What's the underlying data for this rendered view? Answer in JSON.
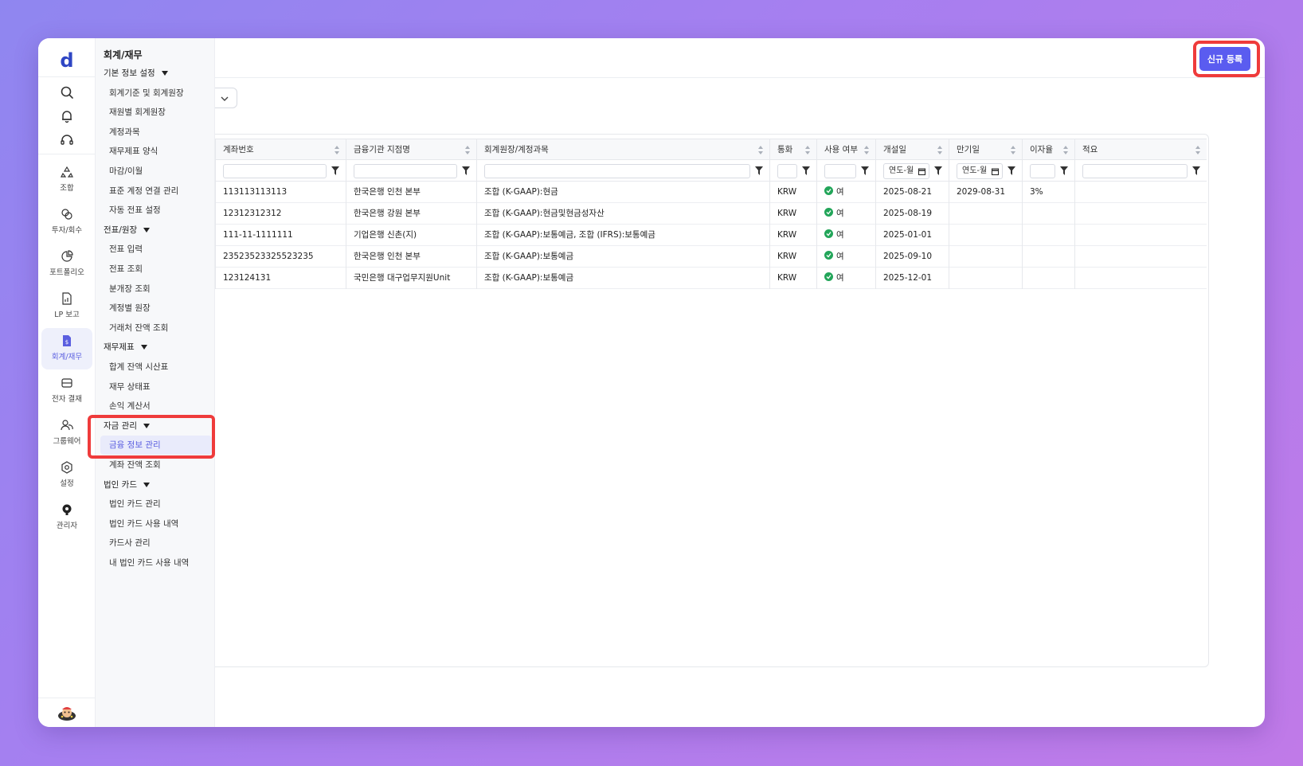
{
  "app": {
    "logo": "d"
  },
  "rail": {
    "items": [
      {
        "label": "조합",
        "icon": "recycle-icon"
      },
      {
        "label": "투자/회수",
        "icon": "coins-icon"
      },
      {
        "label": "포트폴리오",
        "icon": "pie-chart-icon"
      },
      {
        "label": "LP 보고",
        "icon": "report-icon"
      },
      {
        "label": "회계/재무",
        "icon": "ledger-icon",
        "active": true
      },
      {
        "label": "전자 결재",
        "icon": "inbox-icon"
      },
      {
        "label": "그룹웨어",
        "icon": "users-icon"
      },
      {
        "label": "설정",
        "icon": "gear-icon"
      },
      {
        "label": "관리자",
        "icon": "admin-icon"
      }
    ]
  },
  "menu": {
    "title": "회계/재무",
    "groups": [
      {
        "label": "기본 정보 설정",
        "items": [
          "회계기준 및 회계원장",
          "재원별 회계원장",
          "계정과목",
          "재무제표 양식",
          "마감/이월",
          "표준 계정 연결 관리",
          "자동 전표 설정"
        ]
      },
      {
        "label": "전표/원장",
        "items": [
          "전표 입력",
          "전표 조회",
          "분개장 조회",
          "계정별 원장",
          "거래처 잔액 조회"
        ]
      },
      {
        "label": "재무제표",
        "items": [
          "합계 잔액 시산표",
          "재무 상태표",
          "손익 계산서"
        ]
      },
      {
        "label": "자금 관리",
        "items": [
          "금융 정보 관리",
          "계좌 잔액 조회"
        ]
      },
      {
        "label": "법인 카드",
        "items": [
          "법인 카드 관리",
          "법인 카드 사용 내역",
          "카드사 관리",
          "내 법인 카드 사용 내역"
        ]
      }
    ],
    "selected": "금융 정보 관리"
  },
  "toolbar": {
    "new_label": "신규 등록"
  },
  "table": {
    "columns": [
      "계좌번호",
      "금융기관 지점명",
      "회계원장/계정과목",
      "통화",
      "사용 여부",
      "개설일",
      "만기일",
      "이자율",
      "적요"
    ],
    "date_placeholder": "연도-월",
    "rows": [
      [
        "113113113113",
        "한국은행 인천 본부",
        "조합 (K-GAAP):현금",
        "KRW",
        "여",
        "2025-08-21",
        "2029-08-31",
        "3%",
        ""
      ],
      [
        "12312312312",
        "한국은행 강원 본부",
        "조합 (K-GAAP):현금및현금성자산",
        "KRW",
        "여",
        "2025-08-19",
        "",
        "",
        ""
      ],
      [
        "111-11-1111111",
        "기업은행 신촌(지)",
        "조합 (K-GAAP):보통예금, 조합 (IFRS):보통예금",
        "KRW",
        "여",
        "2025-01-01",
        "",
        "",
        ""
      ],
      [
        "23523523325523235",
        "한국은행 인천 본부",
        "조합 (K-GAAP):보통예금",
        "KRW",
        "여",
        "2025-09-10",
        "",
        "",
        ""
      ],
      [
        "123124131",
        "국민은행 대구업무지원Unit",
        "조합 (K-GAAP):보통예금",
        "KRW",
        "여",
        "2025-12-01",
        "",
        "",
        ""
      ]
    ]
  },
  "colors": {
    "accent": "#5a5cf0",
    "highlight": "#ef3b3b",
    "success": "#22a559"
  }
}
